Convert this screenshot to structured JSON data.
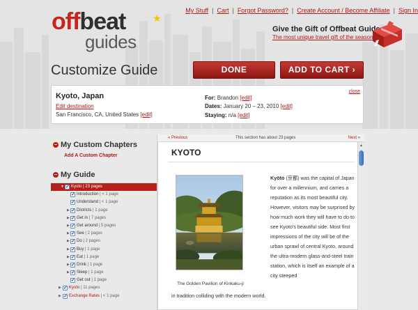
{
  "colors": {
    "brand_red": "#b5201b",
    "link_red": "#b01818",
    "checkbox_blue": "#2d4f8f"
  },
  "logo": {
    "part1": "off",
    "part2": "beat",
    "line2": "guides"
  },
  "topnav": [
    {
      "label": "My Stuff"
    },
    {
      "label": "Cart"
    },
    {
      "label": "Forgot Password?"
    },
    {
      "label": "Create Account / Become Affiliate"
    },
    {
      "label": "Sign In"
    }
  ],
  "gift": {
    "title": "Give the Gift of Offbeat Guides",
    "link": "The most unique travel gift of the season!"
  },
  "page_title": "Customize Guide",
  "buttons": {
    "done": "DONE",
    "add_to_cart": "ADD TO CART ›"
  },
  "info": {
    "destination": "Kyoto, Japan",
    "edit_destination": "Edit destination",
    "home": "San Francisco, CA, United States",
    "edit": "[edit]",
    "for_label": "For:",
    "for_value": "Brandon",
    "dates_label": "Dates:",
    "dates_value": "January 20 – 23, 2010",
    "staying_label": "Staying:",
    "staying_value": "n/a",
    "close": "close"
  },
  "sidebar": {
    "custom_chapters_title": "My Custom Chapters",
    "add_chapter": "Add A Custom Chapter",
    "my_guide_title": "My Guide",
    "tree": [
      {
        "name": "Kyoto",
        "count": " | 23 pages",
        "level": "l0",
        "state": "active",
        "arrow": "▼"
      },
      {
        "name": "Introduction",
        "count": " | < 1 page",
        "level": "l1",
        "state": "",
        "arrow": ""
      },
      {
        "name": "Understand",
        "count": " | < 1 page",
        "level": "l1",
        "state": "",
        "arrow": ""
      },
      {
        "name": "Districts",
        "count": " | 1 page",
        "level": "l1",
        "state": "",
        "arrow": "▶"
      },
      {
        "name": "Get in",
        "count": " | 7 pages",
        "level": "l1",
        "state": "",
        "arrow": "▶"
      },
      {
        "name": "Get around",
        "count": " | 5 pages",
        "level": "l1",
        "state": "",
        "arrow": "▶"
      },
      {
        "name": "See",
        "count": " | 2 pages",
        "level": "l1",
        "state": "",
        "arrow": "▶"
      },
      {
        "name": "Do",
        "count": " | 2 pages",
        "level": "l1",
        "state": "",
        "arrow": "▶"
      },
      {
        "name": "Buy",
        "count": " | 1 page",
        "level": "l1",
        "state": "",
        "arrow": "▶"
      },
      {
        "name": "Eat",
        "count": " | 1 page",
        "level": "l1",
        "state": "",
        "arrow": "▶"
      },
      {
        "name": "Drink",
        "count": " | 1 page",
        "level": "l1",
        "state": "",
        "arrow": "▶"
      },
      {
        "name": "Sleep",
        "count": " | 1 page",
        "level": "l1",
        "state": "",
        "arrow": "▶"
      },
      {
        "name": "Get out",
        "count": " | 1 page",
        "level": "l1",
        "state": "",
        "arrow": ""
      },
      {
        "name": "Kyoto",
        "count": " | 11 pages",
        "level": "l2",
        "state": "red",
        "arrow": "▶"
      },
      {
        "name": "Exchange Rates",
        "count": " | < 1 page",
        "level": "l2",
        "state": "red",
        "arrow": "▶"
      }
    ]
  },
  "pager": {
    "prev": "« Previous",
    "note": "This section has about 23 pages",
    "next": "Next »"
  },
  "article": {
    "title": "KYOTO",
    "caption": "The Golden Pavilion of Kinkaku-ji",
    "lead_bold": "Kyōto",
    "body": " (京都) was the capital of Japan for over a millennium, and carries a reputation as its most beautiful city. However, visitors may be surprised by how much work they will have to do to see Kyoto's beautiful side. Most first impressions of the city will be of the urban sprawl of central Kyoto, around the ultra-modern glass-and-steel train station, which is itself an example of a city steeped",
    "tail": "in tradition colliding with the modern world."
  }
}
